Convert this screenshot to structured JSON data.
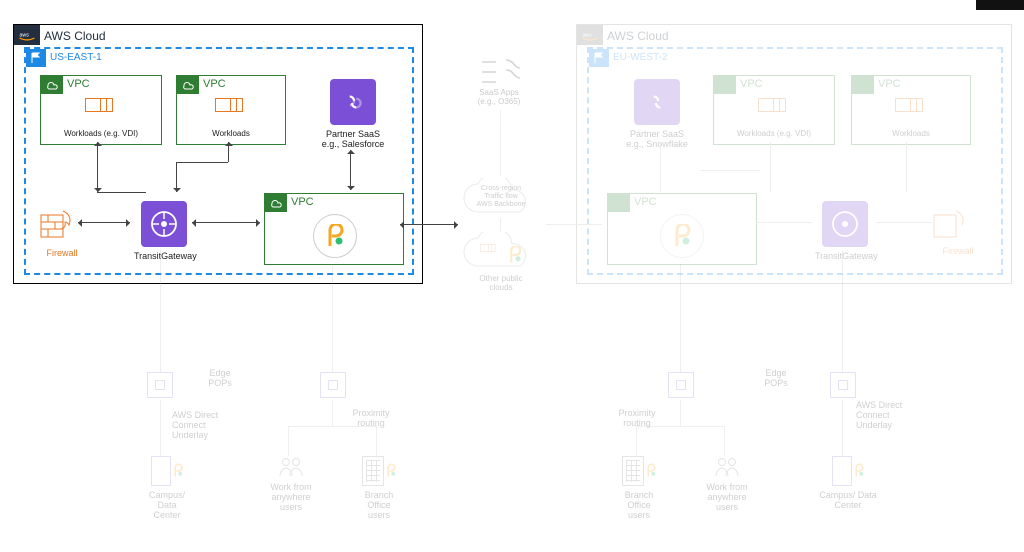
{
  "left_cloud": {
    "title": "AWS Cloud",
    "region": "US-EAST-1",
    "vpc1_title": "VPC",
    "vpc1_caption": "Workloads (e.g. VDI)",
    "vpc2_title": "VPC",
    "vpc2_caption": "Workloads",
    "saas_title": "Partner SaaS\ne.g., Salesforce",
    "vpc3_title": "VPC",
    "tgw_caption": "TransitGateway",
    "fw_caption": "Firewall"
  },
  "right_cloud": {
    "title": "AWS Cloud",
    "region": "EU-WEST-2",
    "vpc1_title": "VPC",
    "vpc1_caption": "Workloads (e.g. VDI)",
    "vpc2_title": "VPC",
    "vpc2_caption": "Workloads",
    "saas_title": "Partner SaaS\ne.g., Snowflake",
    "vpc3_title": "VPC",
    "tgw_caption": "TransitGateway",
    "fw_caption": "Firewall"
  },
  "center": {
    "saas_apps": "SaaS Apps\n(e.g., O365)",
    "cloud1_a": "Cross-region",
    "cloud1_b": "Traffic flow",
    "cloud1_c": "AWS Backbone",
    "cloud2": "Other public\nclouds"
  },
  "bottom": {
    "edge": "Edge\nPOPs",
    "dc": "Campus/ Data\nCenter",
    "dc_side": "AWS Direct\nConnect\nUnderlay",
    "wfa": "Work from\nanywhere\nusers",
    "branch": "Branch\nOffice\nusers",
    "prox": "Proximity\nrouting"
  },
  "colors": {
    "vpc": "#2e7d32",
    "aws": "#232f3e",
    "region": "#1e88e5",
    "purple": "#7b4fd6",
    "orange": "#e87722"
  }
}
